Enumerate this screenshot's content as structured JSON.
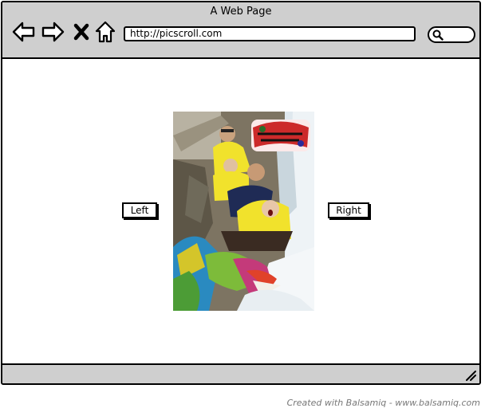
{
  "window": {
    "title": "A Web Page"
  },
  "toolbar": {
    "url": "http://picscroll.com",
    "back_icon": "arrow-left-icon",
    "forward_icon": "arrow-right-icon",
    "stop_icon": "close-x-icon",
    "home_icon": "home-icon",
    "search_icon": "search-icon"
  },
  "content": {
    "left_button_label": "Left",
    "right_button_label": "Right",
    "photo": {
      "subject": "log flume ride photo",
      "logo_lettering": "Dudley Do-Right's Ripsaw Falls"
    }
  },
  "footer": {
    "credit": "Created with Balsamiq - www.balsamiq.com"
  },
  "colors": {
    "chrome": "#cfcfcf",
    "border": "#000000",
    "credit_text": "#777777"
  }
}
